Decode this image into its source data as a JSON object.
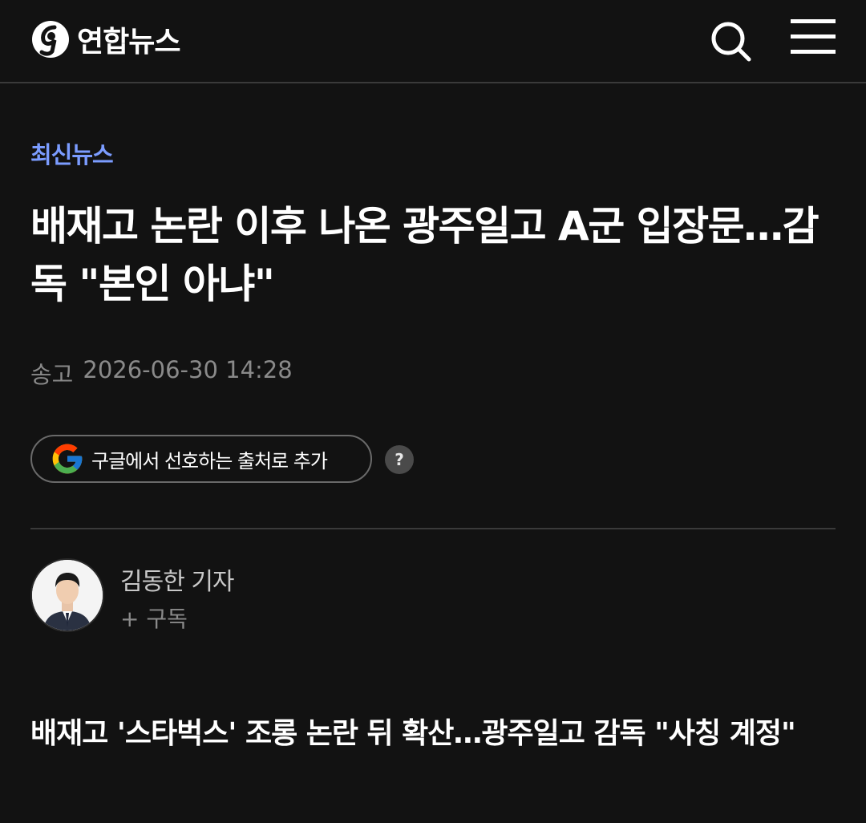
{
  "header": {
    "logo_text": "연합뉴스",
    "logo_icon": "yonhap-logo-icon",
    "search_icon": "search-icon",
    "menu_icon": "hamburger-menu-icon"
  },
  "article": {
    "category": "최신뉴스",
    "title": "배재고 논란 이후 나온 광주일고 A군 입장문…감독 \"본인 아냐\"",
    "published_label": "송고",
    "published_time": "2026-06-30 14:28",
    "google_button_label": "구글에서 선호하는 출처로 추가",
    "help_label": "?",
    "subhead": "배재고 '스타벅스' 조롱 논란 뒤 확산…광주일고 감독 \"사칭 계정\""
  },
  "reporter": {
    "name": "김동한 기자",
    "subscribe_label": "+ 구독"
  },
  "colors": {
    "background": "#121212",
    "category": "#7b9cff",
    "muted": "#8a8a8a"
  }
}
